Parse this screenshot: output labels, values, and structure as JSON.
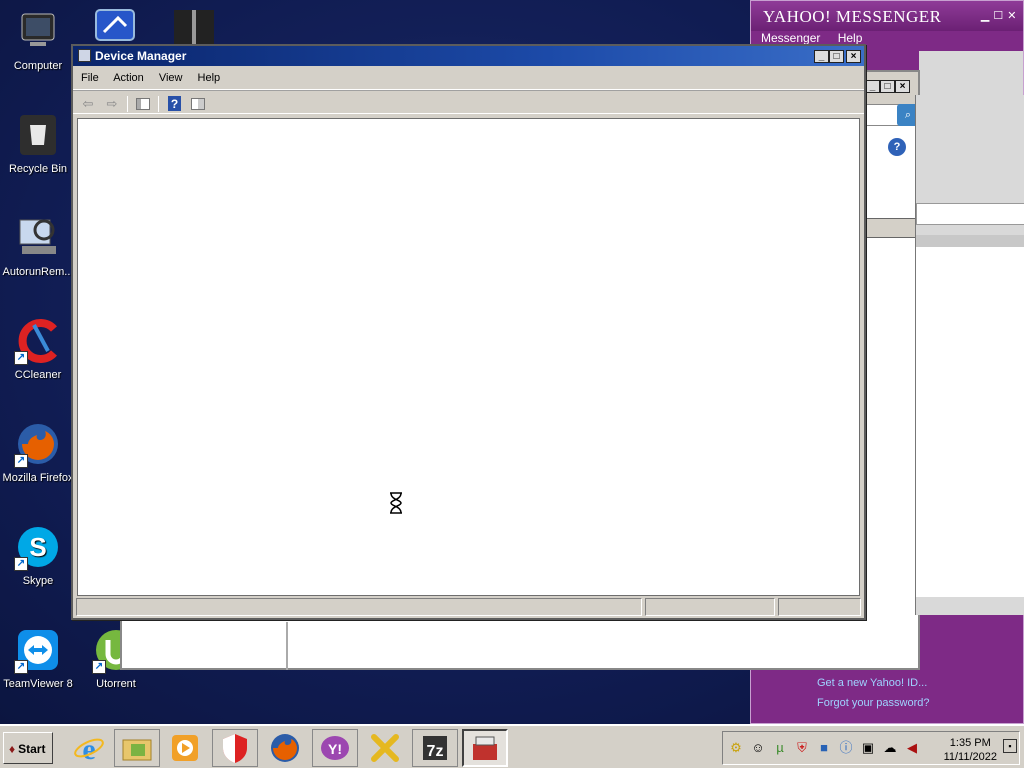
{
  "desktop": {
    "icons": [
      {
        "label": "Computer",
        "icon": "computer-icon"
      },
      {
        "label": "Recycle Bin",
        "icon": "recycle-bin-icon"
      },
      {
        "label": "AutorunRem...",
        "icon": "autorun-remover-icon"
      },
      {
        "label": "CCleaner",
        "icon": "ccleaner-icon"
      },
      {
        "label": "Mozilla Firefox",
        "icon": "firefox-icon"
      },
      {
        "label": "Skype",
        "icon": "skype-icon"
      },
      {
        "label": "TeamViewer 8",
        "icon": "teamviewer-icon"
      },
      {
        "label": "Utorrent",
        "icon": "utorrent-icon"
      }
    ]
  },
  "yahoo": {
    "title": "YAHOO! MESSENGER",
    "menu": [
      "Messenger",
      "Help"
    ],
    "link_new_id": "Get a new Yahoo! ID...",
    "link_forgot": "Forgot your password?"
  },
  "device_manager": {
    "title": "Device Manager",
    "menu": [
      "File",
      "Action",
      "View",
      "Help"
    ],
    "toolbar": [
      "back-icon",
      "forward-icon",
      "show-hide-tree-icon",
      "help-icon",
      "properties-icon"
    ]
  },
  "taskbar": {
    "start_label": "Start",
    "items": [
      "internet-explorer-icon",
      "file-explorer-icon",
      "media-player-icon",
      "security-shield-icon",
      "firefox-icon",
      "yahoo-messenger-icon",
      "tools-icon",
      "archive-icon",
      "device-manager-icon"
    ],
    "tray": [
      "network-icon",
      "smiley-icon",
      "utorrent-icon",
      "antivirus-icon",
      "bluetooth-icon",
      "info-icon",
      "monitor-icon",
      "messenger-icon",
      "volume-icon"
    ],
    "time": "1:35 PM",
    "date": "11/11/2022"
  },
  "colors": {
    "desktop": "#101c52",
    "titlebar": "#0a246a",
    "yahoo_purple": "#7e2a86"
  }
}
